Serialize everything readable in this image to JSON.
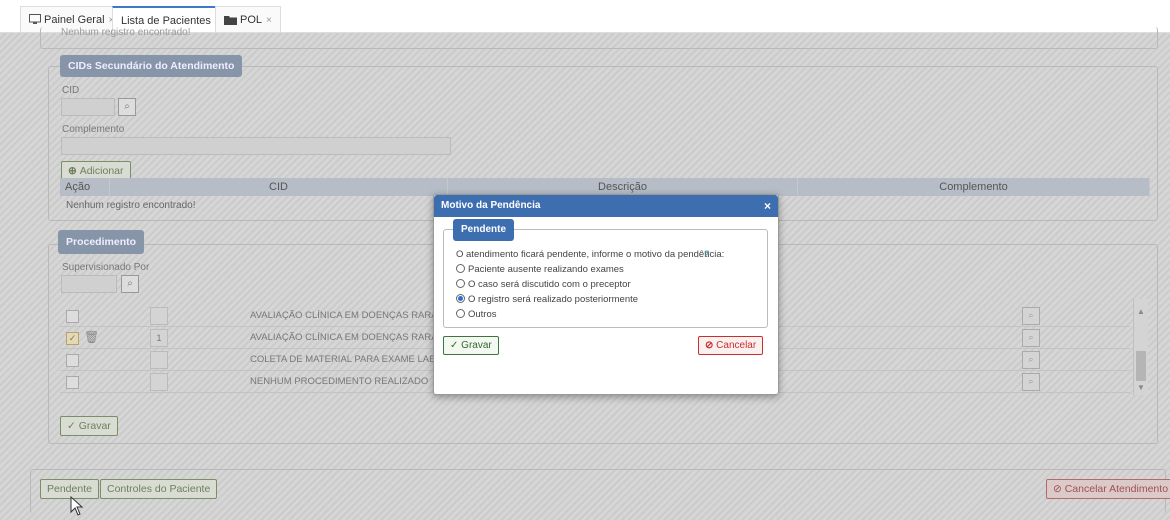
{
  "tabs": [
    {
      "label": "Painel Geral",
      "icon": "monitor-icon"
    },
    {
      "label": "Lista de Pacientes",
      "icon": ""
    },
    {
      "label": "POL",
      "icon": "folder-icon"
    }
  ],
  "tab_close": "×",
  "top_partial_text": "Nenhum registro encontrado!",
  "cid_section": {
    "legend": "CIDs Secundário do Atendimento",
    "cid_label": "CID",
    "complemento_label": "Complemento",
    "add_label": "Adicionar",
    "columns": [
      "Ação",
      "CID",
      "Descrição",
      "Complemento"
    ],
    "empty_text": "Nenhum registro encontrado!"
  },
  "procedimento": {
    "legend": "Procedimento",
    "supervisionado_label": "Supervisionado Por",
    "rows": [
      {
        "checked": false,
        "trash": false,
        "qty": "",
        "name": "AVALIAÇÃO CLÍNICA EM DOENÇAS RARAS - "
      },
      {
        "checked": true,
        "trash": true,
        "qty": "1",
        "name": "AVALIAÇÃO CLÍNICA EM DOENÇAS RARAS N"
      },
      {
        "checked": false,
        "trash": false,
        "qty": "",
        "name": "COLETA DE MATERIAL PARA EXAME LABORA"
      },
      {
        "checked": false,
        "trash": false,
        "qty": "",
        "name": "NENHUM PROCEDIMENTO REALIZADO"
      }
    ],
    "save_label": "Gravar"
  },
  "footer": {
    "pendente": "Pendente",
    "controles": "Controles do Paciente",
    "cancelar": "Cancelar Atendimento"
  },
  "modal": {
    "title": "Motivo da Pendência",
    "close": "×",
    "legend": "Pendente",
    "prompt": "O atendimento ficará pendente, informe o motivo da pendência:",
    "help": "?",
    "options": [
      {
        "label": "Paciente ausente realizando exames",
        "selected": false
      },
      {
        "label": "O caso será discutido com o preceptor",
        "selected": false
      },
      {
        "label": "O registro será realizado posteriormente",
        "selected": true
      },
      {
        "label": "Outros",
        "selected": false
      }
    ],
    "save": "Gravar",
    "cancel": "Cancelar"
  },
  "colors": {
    "accent": "#3d6eb0",
    "danger": "#c9302c",
    "success": "#3c763d"
  }
}
